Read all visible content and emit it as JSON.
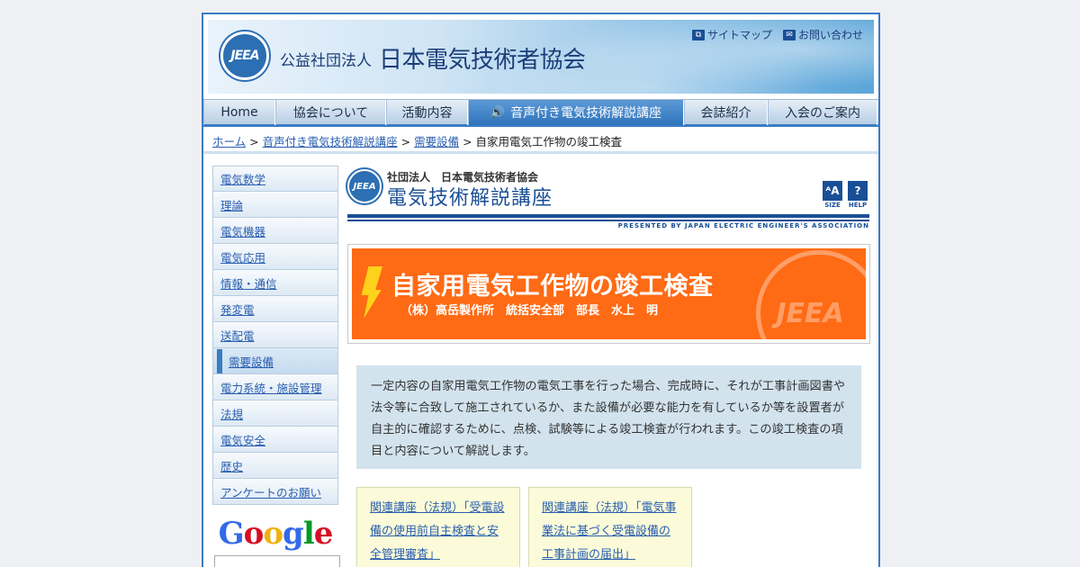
{
  "header": {
    "logo_text": "JEEA",
    "org_prefix": "公益社団法人",
    "org_name": "日本電気技術者協会",
    "sitemap_label": "サイトマップ",
    "contact_label": "お問い合わせ"
  },
  "nav": {
    "tabs": [
      {
        "label": "Home"
      },
      {
        "label": "協会について"
      },
      {
        "label": "活動内容"
      },
      {
        "label": "音声付き電気技術解説講座"
      },
      {
        "label": "会誌紹介"
      },
      {
        "label": "入会のご案内"
      }
    ]
  },
  "breadcrumb": {
    "items": [
      "ホーム",
      "音声付き電気技術解説講座",
      "需要設備"
    ],
    "separator": ">",
    "current": "自家用電気工作物の竣工検査"
  },
  "sidebar": {
    "items": [
      {
        "label": "電気数学"
      },
      {
        "label": "理論"
      },
      {
        "label": "電気機器"
      },
      {
        "label": "電気応用"
      },
      {
        "label": "情報・通信"
      },
      {
        "label": "発変電"
      },
      {
        "label": "送配電"
      },
      {
        "label": "需要設備"
      },
      {
        "label": "電力系統・施設管理"
      },
      {
        "label": "法規"
      },
      {
        "label": "電気安全"
      },
      {
        "label": "歴史"
      },
      {
        "label": "アンケートのお願い"
      }
    ],
    "google_label": "Google"
  },
  "lecture_header": {
    "logo_text": "JEEA",
    "assoc": "社団法人　日本電気技術者協会",
    "course": "電気技術解説講座",
    "presented": "PRESENTED BY JAPAN ELECTRIC ENGINEER'S ASSOCIATION",
    "size_label": "SIZE",
    "help_label": "HELP"
  },
  "banner": {
    "title": "自家用電気工作物の竣工検査",
    "author": "（株）高岳製作所　統括安全部　部長　水上　明",
    "watermark": "JEEA"
  },
  "summary": {
    "text": "一定内容の自家用電気工作物の電気工事を行った場合、完成時に、それが工事計画図書や法令等に合致して施工されているか、また設備が必要な能力を有しているか等を設置者が自主的に確認するために、点検、試験等による竣工検査が行われます。この竣工検査の項目と内容について解説します。"
  },
  "related": [
    {
      "label": "関連講座（法規）「受電設備の使用前自主検査と安全管理審査」"
    },
    {
      "label": "関連講座（法規）「電気事業法に基づく受電設備の工事計画の届出」"
    }
  ]
}
